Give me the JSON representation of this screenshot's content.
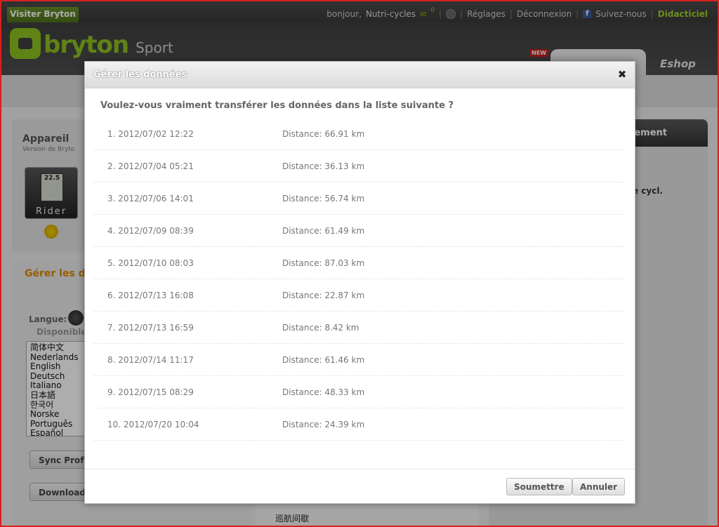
{
  "topbar": {
    "visit_label": "Visiter Bryton",
    "greeting": "bonjour,",
    "username": "Nutri-cycles",
    "mail_icon": "mail-icon",
    "mail_count": "0",
    "settings": "Réglages",
    "logout": "Déconnexion",
    "follow": "Suivez-nous",
    "tutorial": "Didacticiel"
  },
  "header": {
    "logo_text": "bryton",
    "logo_sport": "Sport",
    "new_badge": "NEW",
    "eshop": "Eshop"
  },
  "device_panel": {
    "title": "Appareil",
    "subtitle": "Version de Bryto",
    "device_name": "Rider",
    "screen_value": "22.5"
  },
  "manage_panel": {
    "title": "Gérer les do",
    "language_label": "Langue:",
    "available_label": "Disponible",
    "languages": [
      "简体中文",
      "Nederlands",
      "English",
      "Deutsch",
      "Italiano",
      "日本語",
      "한국어",
      "Norske",
      "Português",
      "Español"
    ],
    "sync_button": "Sync Profil",
    "download_button": "Download"
  },
  "right_panel": {
    "header_text": "ement",
    "snippet": "e cycl."
  },
  "bottom_strip": {
    "text": "巡航间歇"
  },
  "dialog": {
    "title": "Gérer les données",
    "question": "Voulez-vous vraiment transférer les données dans la liste suivante ?",
    "rows": [
      {
        "date": "1. 2012/07/02 12:22",
        "distance": "Distance: 66.91 km"
      },
      {
        "date": "2. 2012/07/04 05:21",
        "distance": "Distance: 36.13 km"
      },
      {
        "date": "3. 2012/07/06 14:01",
        "distance": "Distance: 56.74 km"
      },
      {
        "date": "4. 2012/07/09 08:39",
        "distance": "Distance: 61.49 km"
      },
      {
        "date": "5. 2012/07/10 08:03",
        "distance": "Distance: 87.03 km"
      },
      {
        "date": "6. 2012/07/13 16:08",
        "distance": "Distance: 22.87 km"
      },
      {
        "date": "7. 2012/07/13 16:59",
        "distance": "Distance: 8.42 km"
      },
      {
        "date": "8. 2012/07/14 11:17",
        "distance": "Distance: 61.46 km"
      },
      {
        "date": "9. 2012/07/15 08:29",
        "distance": "Distance: 48.33 km"
      },
      {
        "date": "10. 2012/07/20 10:04",
        "distance": "Distance: 24.39 km"
      }
    ],
    "submit_button": "Soumettre",
    "cancel_button": "Annuler",
    "close_glyph": "✖"
  },
  "colors": {
    "brand_green": "#8dc21f",
    "accent_orange": "#e08a00",
    "frame_red": "#d8201f"
  }
}
